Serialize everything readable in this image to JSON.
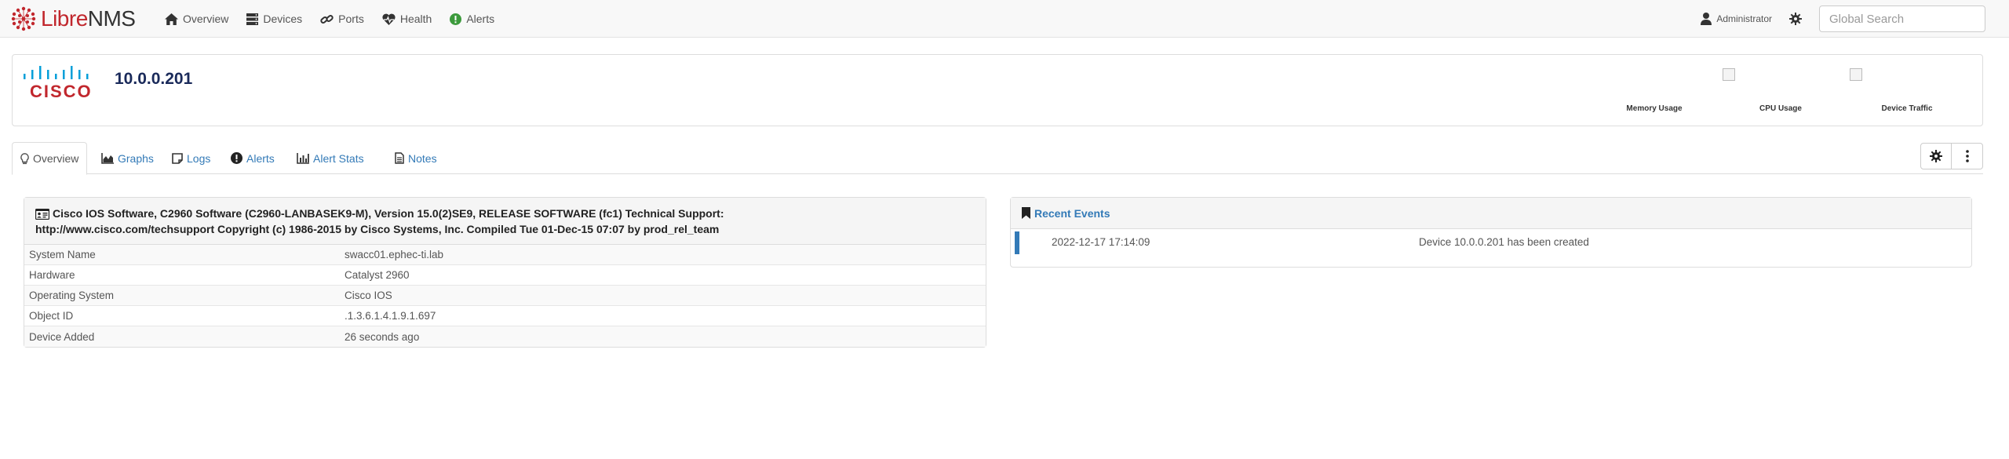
{
  "navbar": {
    "brand_libre": "Libre",
    "brand_nms": "NMS",
    "links": [
      {
        "label": "Overview",
        "icon": "home-icon"
      },
      {
        "label": "Devices",
        "icon": "server-icon"
      },
      {
        "label": "Ports",
        "icon": "link-icon"
      },
      {
        "label": "Health",
        "icon": "heartbeat-icon"
      },
      {
        "label": "Alerts",
        "icon": "exclamation-circle-icon"
      }
    ],
    "user_label": "Administrator",
    "search_placeholder": "Global Search"
  },
  "device": {
    "vendor_logo_text": "CISCO",
    "hostname": "10.0.0.201",
    "graphs": [
      {
        "label": "Memory Usage"
      },
      {
        "label": "CPU Usage"
      },
      {
        "label": "Device Traffic"
      }
    ]
  },
  "tabs": [
    {
      "label": "Overview",
      "icon": "lightbulb-icon",
      "active": true
    },
    {
      "label": "Graphs",
      "icon": "chart-area-icon",
      "active": false
    },
    {
      "label": "Logs",
      "icon": "sticky-note-icon",
      "active": false
    },
    {
      "label": "Alerts",
      "icon": "exclamation-circle-icon",
      "active": false
    },
    {
      "label": "Alert Stats",
      "icon": "bar-chart-icon",
      "active": false
    },
    {
      "label": "Notes",
      "icon": "file-text-icon",
      "active": false
    }
  ],
  "overview": {
    "description_line1": "Cisco IOS Software, C2960 Software (C2960-LANBASEK9-M), Version 15.0(2)SE9, RELEASE SOFTWARE (fc1) Technical Support:",
    "description_line2": "http://www.cisco.com/techsupport Copyright (c) 1986-2015 by Cisco Systems, Inc. Compiled Tue 01-Dec-15 07:07 by prod_rel_team",
    "rows": [
      {
        "key": "System Name",
        "value": "swacc01.ephec-ti.lab"
      },
      {
        "key": "Hardware",
        "value": "Catalyst 2960"
      },
      {
        "key": "Operating System",
        "value": "Cisco IOS"
      },
      {
        "key": "Object ID",
        "value": ".1.3.6.1.4.1.9.1.697"
      },
      {
        "key": "Device Added",
        "value": "26 seconds ago"
      }
    ]
  },
  "events": {
    "title": "Recent Events",
    "items": [
      {
        "time": "2022-12-17 17:14:09",
        "message": "Device 10.0.0.201 has been created"
      }
    ]
  },
  "colors": {
    "link": "#337ab7",
    "brand_red": "#c1272d",
    "cisco_blue": "#049fd9",
    "cisco_red": "#c1272d",
    "hostname": "#1a2a5a"
  }
}
